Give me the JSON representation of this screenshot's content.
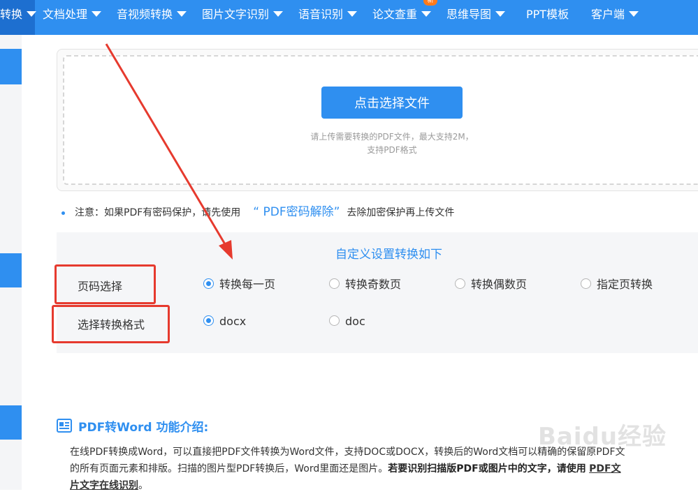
{
  "nav": {
    "items": [
      {
        "label": "转换",
        "has_caret": true,
        "active": true
      },
      {
        "label": "文档处理",
        "has_caret": true
      },
      {
        "label": "音视频转换",
        "has_caret": true
      },
      {
        "label": "图片文字识别",
        "has_caret": true
      },
      {
        "label": "语音识别",
        "has_caret": true
      },
      {
        "label": "论文查重",
        "has_caret": true,
        "badge": "新"
      },
      {
        "label": "思维导图",
        "has_caret": true
      },
      {
        "label": "PPT模板",
        "has_caret": false
      },
      {
        "label": "客户端",
        "has_caret": true
      }
    ]
  },
  "upload": {
    "button_label": "点击选择文件",
    "hint_line1": "请上传需要转换的PDF文件，最大支持2M，",
    "hint_line2": "支持PDF格式"
  },
  "notice": {
    "prefix": "注意：如果PDF有密码保护，请先使用",
    "link": "“ PDF密码解除”",
    "suffix": "去除加密保护再上传文件"
  },
  "settings": {
    "title": "自定义设置转换如下",
    "page_row": {
      "label": "页码选择",
      "options": [
        "转换每一页",
        "转换奇数页",
        "转换偶数页",
        "指定页转换"
      ],
      "selected": "转换每一页"
    },
    "format_row": {
      "label": "选择转换格式",
      "options": [
        "docx",
        "doc"
      ],
      "selected": "docx"
    }
  },
  "intro": {
    "title": "PDF转Word 功能介绍:",
    "line1": "在线PDF转换成Word，可以直接把PDF文件转换为Word文件，支持DOC或DOCX，转换后的Word文档可以精确的保留原PDF文",
    "line2_plain": "的所有页面元素和排版。扫描的图片型PDF转换后，Word里面还是图片。",
    "line2_bold": "若要识别扫描版PDF或图片中的文字，请使用",
    "line2_link": "PDF文",
    "line3_link": "片文字在线识别",
    "line3_tail": "。"
  },
  "watermark": "Baidu经验",
  "colors": {
    "brand_blue": "#2f8ff0",
    "annotation_red": "#e63a2e",
    "badge_orange": "#ff7a1a"
  }
}
